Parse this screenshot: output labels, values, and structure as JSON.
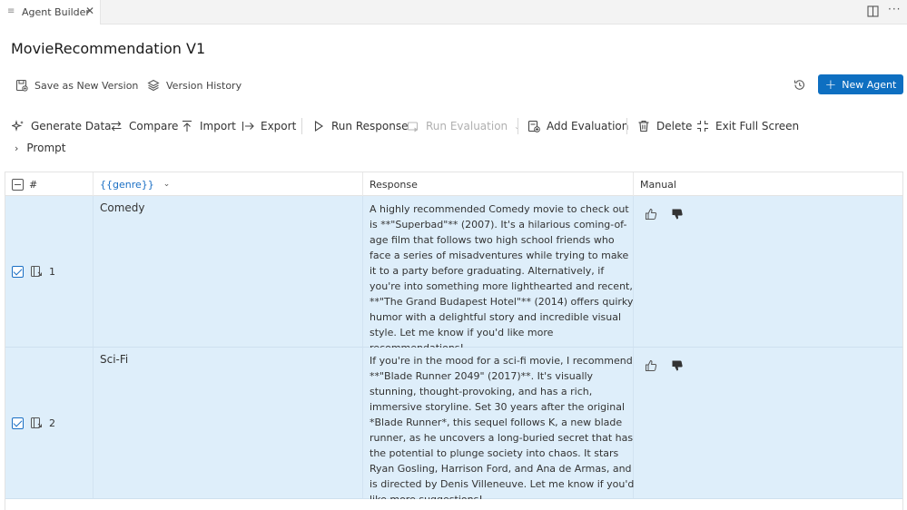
{
  "tab": {
    "title": "Agent Builder",
    "menu_icon": "menu-icon",
    "close_icon": "close-icon"
  },
  "window_icons": [
    "split-editor-icon",
    "more-icon"
  ],
  "page_title": "MovieRecommendation V1",
  "actions": {
    "save_as_new_version": "Save as New Version",
    "version_history": "Version History",
    "new_agent": "New Agent"
  },
  "toolbar": {
    "generate_data": "Generate Data",
    "compare": "Compare",
    "import": "Import",
    "export": "Export",
    "run_response": "Run Response",
    "run_evaluation": "Run Evaluation",
    "add_evaluation": "Add Evaluation",
    "delete": "Delete",
    "exit_full_screen": "Exit Full Screen",
    "prompt": "Prompt"
  },
  "table": {
    "headers": {
      "index": "#",
      "genre": "{{genre}}",
      "response": "Response",
      "manual": "Manual"
    },
    "rows": [
      {
        "index": "1",
        "genre": "Comedy",
        "checked": true,
        "response": "A highly recommended Comedy movie to check out is **\"Superbad\"** (2007). It's a hilarious coming-of-age film that follows two high school friends who face a series of misadventures while trying to make it to a party before graduating. Alternatively, if you're into something more lighthearted and recent, **\"The Grand Budapest Hotel\"** (2014) offers quirky humor with a delightful story and incredible visual style. Let me know if you'd like more recommendations!"
      },
      {
        "index": "2",
        "genre": "Sci-Fi",
        "checked": true,
        "response": "If you're in the mood for a sci-fi movie, I recommend **\"Blade Runner 2049\" (2017)**. It's visually stunning, thought-provoking, and has a rich, immersive storyline. Set 30 years after the original *Blade Runner*, this sequel follows K, a new blade runner, as he uncovers a long-buried secret that has the potential to plunge society into chaos. It stars Ryan Gosling, Harrison Ford, and Ana de Armas, and is directed by Denis Villeneuve. Let me know if you'd like more suggestions!"
      }
    ]
  },
  "colors": {
    "accent": "#0e6fc1",
    "row_selected": "#deeefa",
    "link": "#1a6fc4"
  }
}
